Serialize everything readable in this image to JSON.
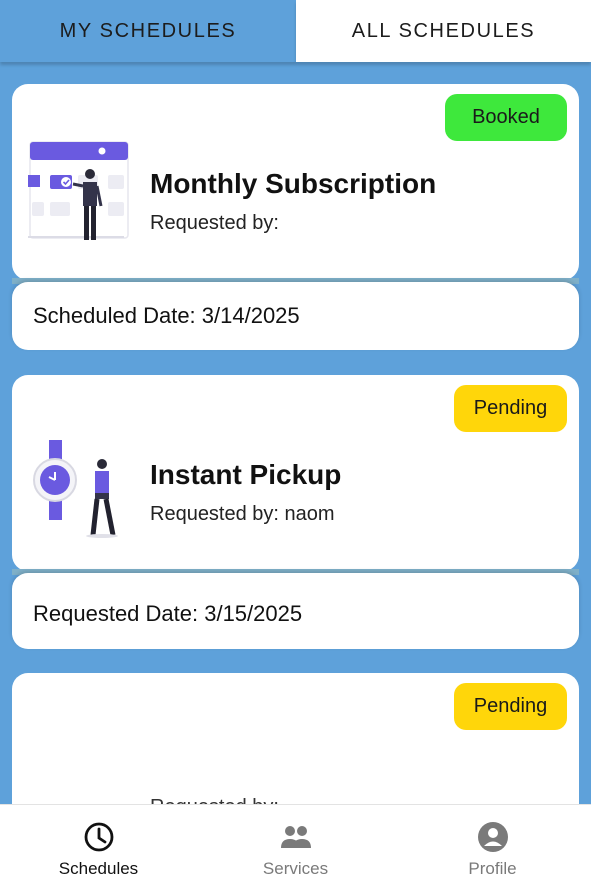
{
  "tabs": {
    "my_schedules": "MY SCHEDULES",
    "all_schedules": "ALL SCHEDULES"
  },
  "cards": [
    {
      "status": "Booked",
      "status_color": "#3ee83c",
      "title": "Monthly Subscription",
      "requested_by": "Requested by:",
      "date_line": "Scheduled Date: 3/14/2025",
      "illustration": "calendar-person-illustration"
    },
    {
      "status": "Pending",
      "status_color": "#ffd60a",
      "title": "Instant Pickup",
      "requested_by": "Requested by: naom",
      "date_line": "Requested Date: 3/15/2025",
      "illustration": "watch-person-illustration"
    },
    {
      "status": "Pending",
      "status_color": "#ffd60a",
      "requested_by_partial": "Requested by:"
    }
  ],
  "bottom_nav": {
    "schedules": "Schedules",
    "services": "Services",
    "profile": "Profile"
  },
  "colors": {
    "background": "#5ea1da",
    "accent_illustration": "#6a5ae0"
  }
}
